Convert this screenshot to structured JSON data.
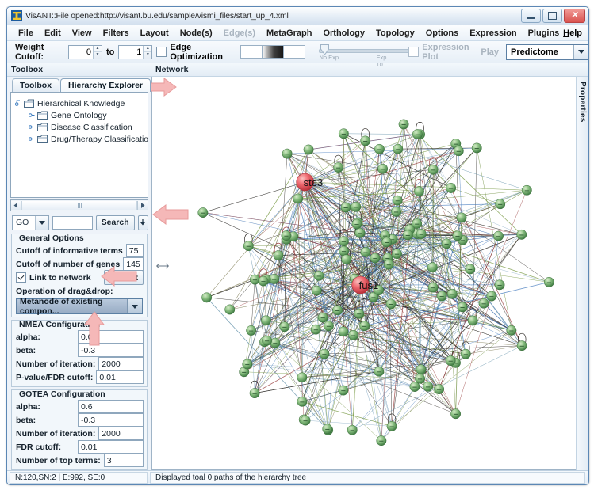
{
  "window": {
    "title": "VisANT::File opened:http://visant.bu.edu/sample/vismi_files/start_up_4.xml",
    "icon": "visant-icon",
    "minimize_label": "Minimize",
    "maximize_label": "Maximize",
    "close_label": "Close"
  },
  "menubar": {
    "items": [
      {
        "label": "File",
        "disabled": false
      },
      {
        "label": "Edit",
        "disabled": false
      },
      {
        "label": "View",
        "disabled": false
      },
      {
        "label": "Filters",
        "disabled": false
      },
      {
        "label": "Layout",
        "disabled": false
      },
      {
        "label": "Node(s)",
        "disabled": false
      },
      {
        "label": "Edge(s)",
        "disabled": true
      },
      {
        "label": "MetaGraph",
        "disabled": false
      },
      {
        "label": "Orthology",
        "disabled": false
      },
      {
        "label": "Topology",
        "disabled": false
      },
      {
        "label": "Options",
        "disabled": false
      },
      {
        "label": "Expression",
        "disabled": false
      },
      {
        "label": "Plugins",
        "disabled": false
      }
    ],
    "help": "Help"
  },
  "toolbar": {
    "weight_cutoff_label": "Weight Cutoff:",
    "weight_cutoff_from": "0",
    "weight_cutoff_to_label": "to",
    "weight_cutoff_to": "1",
    "edge_optimization_label": "Edge Optimization",
    "edge_optimization_checked": false,
    "slider_min_label": "No Exp",
    "slider_max_label": "Exp 10",
    "expression_plot_label": "Expression Plot",
    "expression_plot_checked": false,
    "play_label": "Play",
    "mode_value": "Predictome"
  },
  "left_panel": {
    "header": "Toolbox",
    "tabs": [
      {
        "label": "Toolbox",
        "active": false
      },
      {
        "label": "Hierarchy Explorer",
        "active": true
      }
    ],
    "tree": {
      "root": "Hierarchical Knowledge",
      "children": [
        "Gene Ontology",
        "Disease Classification",
        "Drug/Therapy Classification"
      ]
    },
    "search": {
      "source_value": "GO",
      "input_value": "",
      "button_label": "Search",
      "more_button_label": "More"
    },
    "general_options": {
      "legend": "General Options",
      "rows": [
        {
          "label": "Cutoff of informative terms",
          "value": "75"
        },
        {
          "label": "Cutoff of number of genes",
          "value": "145"
        }
      ],
      "link_to_network_label": "Link to network",
      "link_to_network_checked": true,
      "default_button_label": "Default",
      "drag_drop_label": "Operation of drag&drop:",
      "drag_drop_value": "Metanode of existing compon..."
    },
    "nmea": {
      "legend": "NMEA Configuration",
      "rows": [
        {
          "label": "alpha:",
          "value": "0.05"
        },
        {
          "label": "beta:",
          "value": "-0.3"
        },
        {
          "label": "Number of iteration:",
          "value": "2000"
        },
        {
          "label": "P-value/FDR cutoff:",
          "value": "0.01"
        }
      ]
    },
    "gotea": {
      "legend": "GOTEA Configuration",
      "rows": [
        {
          "label": "alpha:",
          "value": "0.6"
        },
        {
          "label": "beta:",
          "value": "-0.3"
        },
        {
          "label": "Number of iteration:",
          "value": "2000"
        },
        {
          "label": "FDR cutoff:",
          "value": "0.01"
        },
        {
          "label": "Number of top terms:",
          "value": "3"
        }
      ]
    }
  },
  "network_panel": {
    "header": "Network",
    "properties_tab": "Properties",
    "labeled_nodes": [
      {
        "id": "ste3",
        "label": "ste3"
      },
      {
        "id": "fus1",
        "label": "fus1"
      }
    ],
    "node_color": "#7fb97f",
    "highlight_color": "#e8525c"
  },
  "statusbar": {
    "counts": "N:120,SN:2 | E:992, SE:0",
    "message": "Displayed toal 0 paths of the hierarchy tree"
  },
  "annotations": {
    "arrow_color": "#f3b3b3",
    "arrows": [
      {
        "name": "hierarchy-explorer-tab-arrow"
      },
      {
        "name": "search-more-button-arrow"
      },
      {
        "name": "link-to-network-arrow"
      },
      {
        "name": "nmea-configuration-arrow"
      }
    ]
  }
}
